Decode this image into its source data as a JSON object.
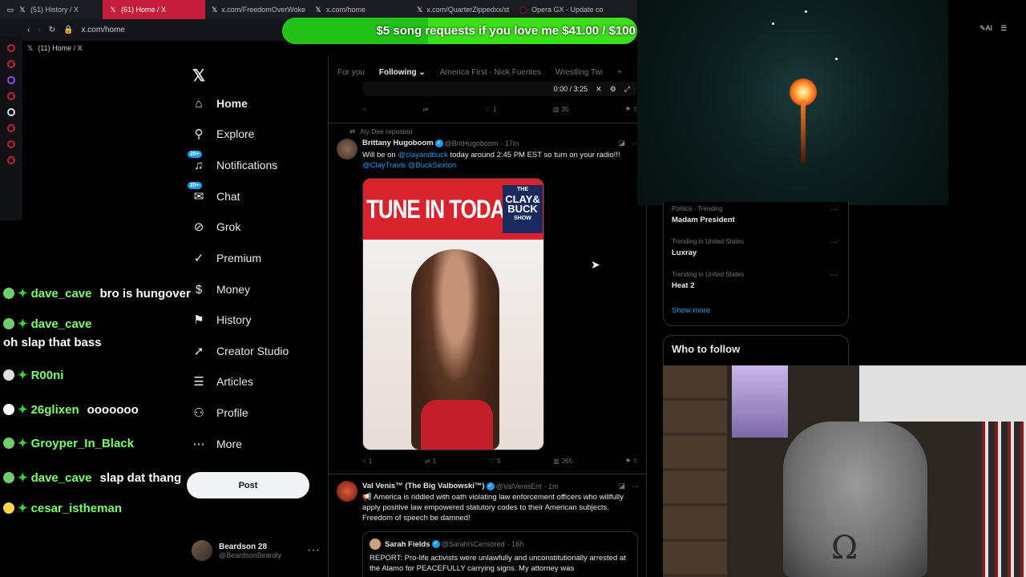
{
  "browser": {
    "tabs": [
      {
        "label": "(51) History / X",
        "icon": "x-icon"
      },
      {
        "label": "(61) Home / X",
        "icon": "x-icon"
      },
      {
        "label": "x.com/FreedomOverWoke",
        "icon": "blank-page-icon"
      },
      {
        "label": "x.com/home",
        "icon": "blank-page-icon"
      },
      {
        "label": "x.com/QuarterZippedxx/st",
        "icon": "blank-page-icon"
      },
      {
        "label": "Opera GX - Update co",
        "icon": "opera-icon"
      }
    ],
    "url": "x.com/home",
    "page_tab_label": "(11) Home / X",
    "ai_label": "AI"
  },
  "donation_bar": {
    "text": "$5 song requests if you love me $41.00 / $100",
    "progress_percent": 41,
    "color": "#3cdf1a"
  },
  "nav": {
    "items": [
      {
        "label": "Home",
        "icon": "home-icon"
      },
      {
        "label": "Explore",
        "icon": "search-icon"
      },
      {
        "label": "Notifications",
        "icon": "bell-icon",
        "badge": "20+"
      },
      {
        "label": "Chat",
        "icon": "chat-icon",
        "badge": "20+"
      },
      {
        "label": "Grok",
        "icon": "grok-icon"
      },
      {
        "label": "Premium",
        "icon": "premium-icon"
      },
      {
        "label": "Money",
        "icon": "money-icon"
      },
      {
        "label": "History",
        "icon": "bookmark-icon"
      },
      {
        "label": "Creator Studio",
        "icon": "rocket-icon"
      },
      {
        "label": "Articles",
        "icon": "articles-icon"
      },
      {
        "label": "Profile",
        "icon": "person-icon"
      },
      {
        "label": "More",
        "icon": "more-circle-icon"
      }
    ],
    "post_label": "Post"
  },
  "account": {
    "name": "Beardson 28",
    "handle": "@BeardsonBeardly"
  },
  "chat_overlay": [
    {
      "user": "dave_cave",
      "message": "bro is hungover"
    },
    {
      "user": "dave_cave",
      "message": "oh slap that bass"
    },
    {
      "user": "R00ni",
      "message": ""
    },
    {
      "user": "26glixen",
      "message": "ooooooo"
    },
    {
      "user": "Groyper_In_Black",
      "message": ""
    },
    {
      "user": "dave_cave",
      "message": "slap dat thang"
    },
    {
      "user": "cesar_istheman",
      "message": ""
    }
  ],
  "feed": {
    "tabs": [
      "For you",
      "Following",
      "America First - Nick Fuentes",
      "Wrestling Twi"
    ],
    "video_time": "0:00 / 3:25",
    "top_actions": {
      "likes": "1",
      "views": "35"
    },
    "tweet1": {
      "repost_by": "Aly Dee reposted",
      "name": "Brittany Hugoboom",
      "handle": "@BritHugoboom",
      "time": "· 17m",
      "text_a": "Will be on ",
      "mention1": "@clayandbuck",
      "text_b": " today around 2:45 PM EST so turn on your radio!!!",
      "mention2": "@ClayTravis @BuckSexton",
      "banner": "TUNE IN TODAY",
      "show_line1": "THE",
      "show_line2": "CLAY&",
      "show_line3": "BUCK",
      "show_line4": "SHOW",
      "replies": "1",
      "reposts": "1",
      "likes": "5",
      "views": "265"
    },
    "tweet2": {
      "name": "Val Venis™ (The Big Valbowski™)",
      "handle": "@ValVenisEnt",
      "time": "· 1m",
      "text": "📢 America is riddled with oath violating law enforcement officers who willfully apply positive law empowered statutory codes to their American subjects. Freedom of speech be damned!",
      "quote_name": "Sarah Fields",
      "quote_handle": "@SarahIsCensored",
      "quote_time": "· 16h",
      "quote_text": "REPORT: Pro-life activists were unlawfully and unconstitutionally arrested at the Alamo for PEACEFULLY carrying signs. My attorney was"
    }
  },
  "trends": [
    {
      "context": "Politics · Trending",
      "title": "Madam President"
    },
    {
      "context": "Trending in United States",
      "title": "Luxray"
    },
    {
      "context": "Trending in United States",
      "title": "Heat 2"
    }
  ],
  "show_more": "Show more",
  "who_to_follow": "Who to follow"
}
